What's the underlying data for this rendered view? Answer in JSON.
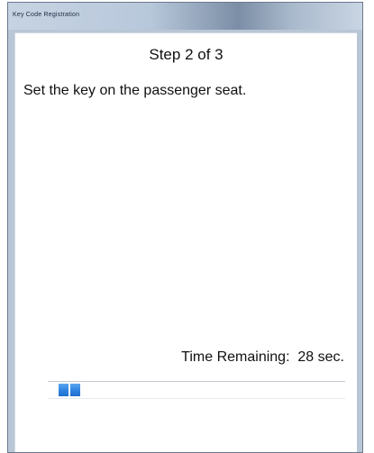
{
  "window": {
    "title": "Key Code Registration"
  },
  "wizard": {
    "step_text": "Step  2 of 3",
    "instruction": "Set the key on the passenger seat.",
    "time_label": "Time Remaining:",
    "time_value": "28 sec."
  },
  "progress": {
    "fraction": 0.08,
    "color": "#2e82e0"
  }
}
